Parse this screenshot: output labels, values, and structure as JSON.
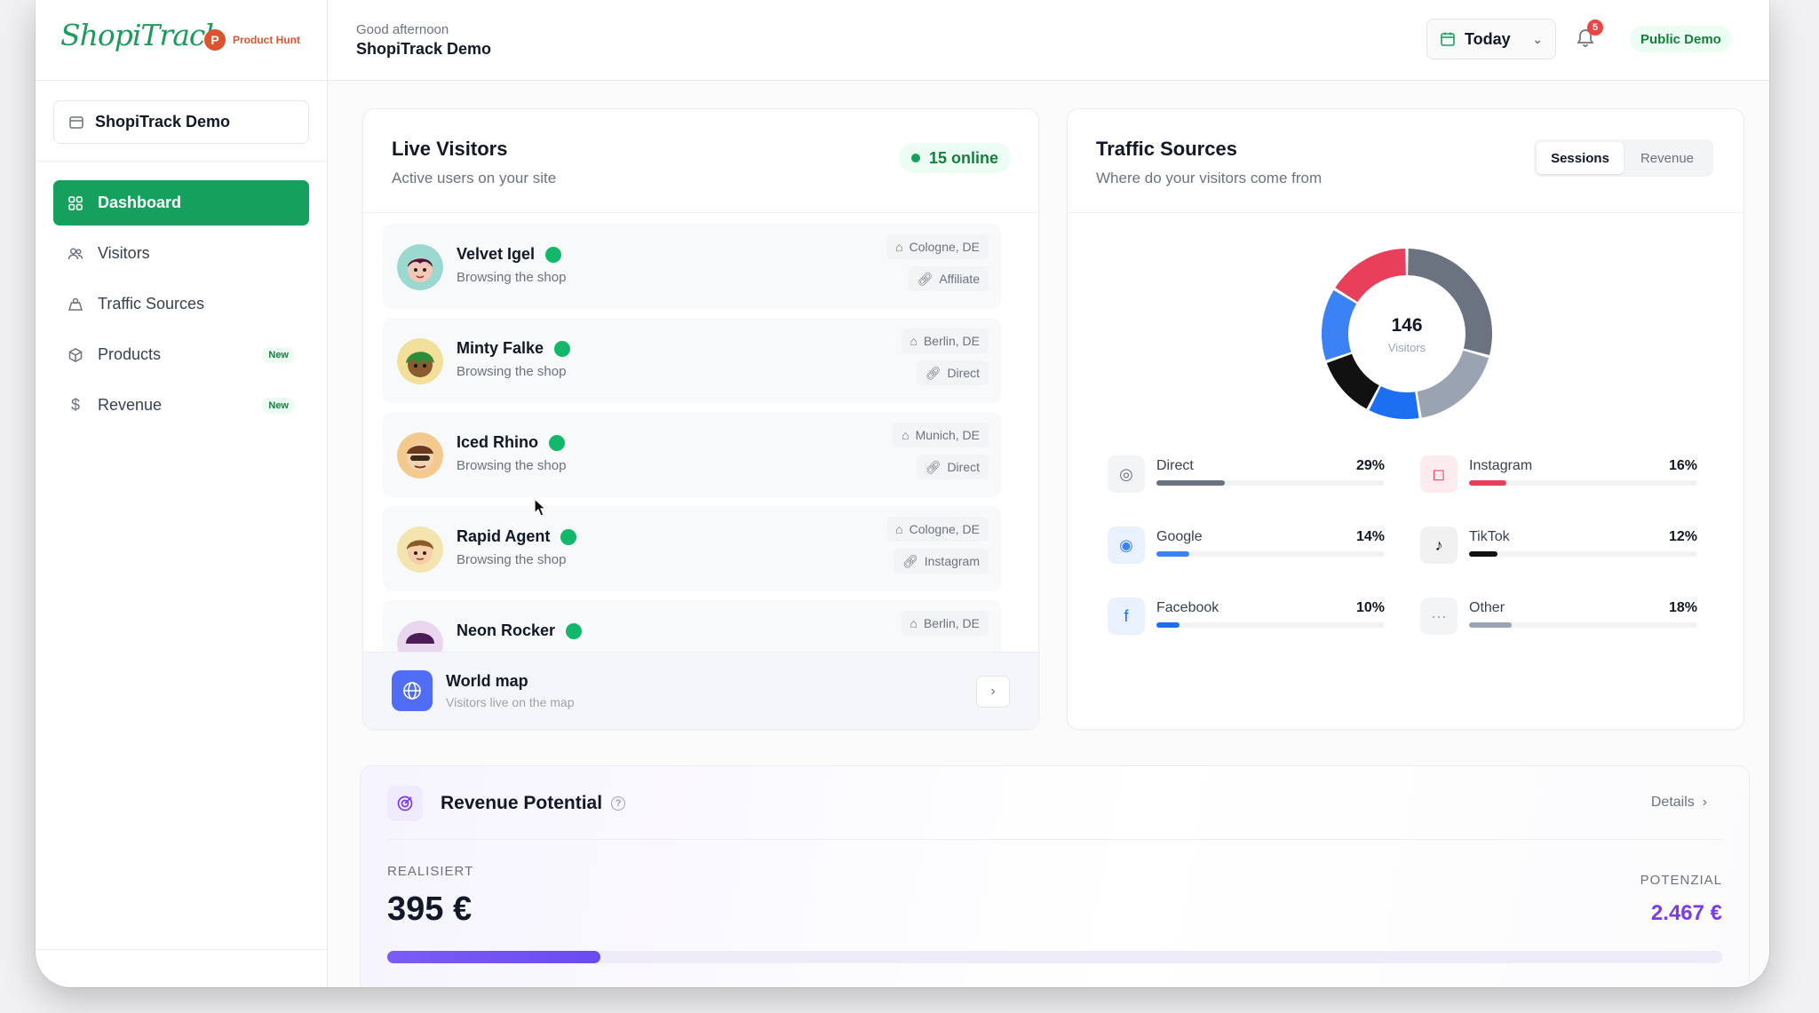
{
  "header": {
    "logo": "ShopiTrack",
    "product_hunt": "Product Hunt",
    "greeting": "Good afternoon",
    "store_name": "ShopiTrack Demo",
    "date_range": "Today",
    "notifications": "5",
    "public_demo": "Public Demo"
  },
  "sidebar": {
    "store_selector": "ShopiTrack Demo",
    "items": [
      {
        "label": "Dashboard",
        "icon": "grid-icon",
        "active": true
      },
      {
        "label": "Visitors",
        "icon": "users-icon"
      },
      {
        "label": "Traffic Sources",
        "icon": "map-icon"
      },
      {
        "label": "Products",
        "icon": "box-icon",
        "badge": "New"
      },
      {
        "label": "Revenue",
        "icon": "dollar-icon",
        "badge": "New"
      }
    ]
  },
  "live": {
    "title": "Live Visitors",
    "subtitle": "Active users on your site",
    "online": "15 online",
    "visitors": [
      {
        "name": "Velvet Igel",
        "status": "Browsing the shop",
        "location": "Cologne, DE",
        "source": "Affiliate"
      },
      {
        "name": "Minty Falke",
        "status": "Browsing the shop",
        "location": "Berlin, DE",
        "source": "Direct"
      },
      {
        "name": "Iced Rhino",
        "status": "Browsing the shop",
        "location": "Munich, DE",
        "source": "Direct"
      },
      {
        "name": "Rapid Agent",
        "status": "Browsing the shop",
        "location": "Cologne, DE",
        "source": "Instagram"
      },
      {
        "name": "Neon Rocker",
        "status": "",
        "location": "Berlin, DE",
        "source": ""
      }
    ],
    "world_map_title": "World map",
    "world_map_sub": "Visitors live on the map"
  },
  "traffic": {
    "title": "Traffic Sources",
    "subtitle": "Where do your visitors come from",
    "tabs": [
      "Sessions",
      "Revenue"
    ],
    "active_tab": "Sessions",
    "total": "146",
    "total_label": "Visitors",
    "colors": {
      "Direct": "#6b7280",
      "Instagram": "#e8405b",
      "Google": "#3b82f6",
      "TikTok": "#111111",
      "Facebook": "#1d6ff2",
      "Other": "#9aa3b2"
    },
    "sources": [
      {
        "name": "Direct",
        "pct": "29%",
        "value": 29,
        "icon": "direct-icon"
      },
      {
        "name": "Instagram",
        "pct": "16%",
        "value": 16,
        "icon": "instagram-icon"
      },
      {
        "name": "Google",
        "pct": "14%",
        "value": 14,
        "icon": "google-icon"
      },
      {
        "name": "TikTok",
        "pct": "12%",
        "value": 12,
        "icon": "tiktok-icon"
      },
      {
        "name": "Facebook",
        "pct": "10%",
        "value": 10,
        "icon": "facebook-icon"
      },
      {
        "name": "Other",
        "pct": "18%",
        "value": 18,
        "icon": "more-icon"
      }
    ]
  },
  "revenue": {
    "title": "Revenue Potential",
    "details": "Details",
    "realized_label": "REALISIERT",
    "realized_value": "395 €",
    "potential_label": "POTENZIAL",
    "potential_value": "2.467 €",
    "progress": 0.16
  }
}
